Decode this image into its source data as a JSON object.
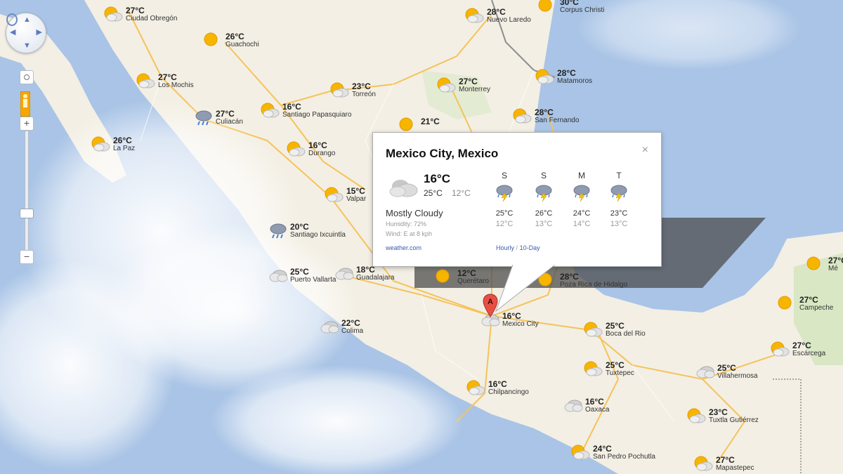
{
  "markers": [
    {
      "temp": "27°C",
      "city": "Ciudad Obregón",
      "icon": "sun-cloud-icon"
    },
    {
      "temp": "26°C",
      "city": "Guachochi",
      "icon": "sun-icon"
    },
    {
      "temp": "27°C",
      "city": "Los Mochis",
      "icon": "sun-cloud-icon"
    },
    {
      "temp": "27°C",
      "city": "Culiacán",
      "icon": "rain-cloud-icon"
    },
    {
      "temp": "26°C",
      "city": "La Paz",
      "icon": "sun-cloud-icon"
    },
    {
      "temp": "16°C",
      "city": "Santiago Papasquiaro",
      "icon": "sun-cloud-icon"
    },
    {
      "temp": "16°C",
      "city": "Durango",
      "icon": "sun-cloud-icon"
    },
    {
      "temp": "15°C",
      "city": "Valpar",
      "icon": "sun-cloud-icon"
    },
    {
      "temp": "20°C",
      "city": "Santiago Ixcuintla",
      "icon": "rain-cloud-icon"
    },
    {
      "temp": "25°C",
      "city": "Puerto Vallarta",
      "icon": "cloud-icon"
    },
    {
      "temp": "18°C",
      "city": "Guadalajara",
      "icon": "cloud-icon"
    },
    {
      "temp": "22°C",
      "city": "Colima",
      "icon": "cloud-icon"
    },
    {
      "temp": "23°C",
      "city": "Torreón",
      "icon": "sun-cloud-icon"
    },
    {
      "temp": "21°C",
      "city": "",
      "icon": "sun-icon"
    },
    {
      "temp": "28°C",
      "city": "Nuevo Laredo",
      "icon": "sun-cloud-icon"
    },
    {
      "temp": "30°C",
      "city": "Corpus Christi",
      "icon": "sun-icon"
    },
    {
      "temp": "27°C",
      "city": "Monterrey",
      "icon": "sun-cloud-icon"
    },
    {
      "temp": "28°C",
      "city": "Matamoros",
      "icon": "sun-cloud-icon"
    },
    {
      "temp": "28°C",
      "city": "San Fernando",
      "icon": "sun-cloud-icon"
    },
    {
      "temp": "12°C",
      "city": "Querétaro",
      "icon": "sun-icon"
    },
    {
      "temp": "28°C",
      "city": "Poza Rica de Hidalgo",
      "icon": "sun-icon"
    },
    {
      "temp": "16°C",
      "city": "Mexico City",
      "icon": "cloud-icon"
    },
    {
      "temp": "25°C",
      "city": "Boca del Rio",
      "icon": "sun-cloud-icon"
    },
    {
      "temp": "25°C",
      "city": "Tuxtepec",
      "icon": "sun-cloud-icon"
    },
    {
      "temp": "25°C",
      "city": "Villahermosa",
      "icon": "cloud-icon"
    },
    {
      "temp": "16°C",
      "city": "Chilpancingo",
      "icon": "sun-cloud-icon"
    },
    {
      "temp": "16°C",
      "city": "Oaxaca",
      "icon": "cloud-icon"
    },
    {
      "temp": "23°C",
      "city": "Tuxtla Gutiérrez",
      "icon": "sun-cloud-icon"
    },
    {
      "temp": "24°C",
      "city": "San Pedro Pochutla",
      "icon": "sun-cloud-icon"
    },
    {
      "temp": "27°C",
      "city": "Mapastepec",
      "icon": "sun-cloud-icon"
    },
    {
      "temp": "27°C",
      "city": "Campeche",
      "icon": "sun-icon"
    },
    {
      "temp": "27°C",
      "city": "Escárcega",
      "icon": "sun-cloud-icon"
    },
    {
      "temp": "27°C",
      "city": "Mé",
      "icon": "sun-icon"
    }
  ],
  "pin_letter": "A",
  "popup": {
    "title": "Mexico City, Mexico",
    "close": "×",
    "current_temp": "16°C",
    "hi": "25°C",
    "lo": "12°C",
    "condition": "Mostly Cloudy",
    "humidity": "Humidity: 72%",
    "wind": "Wind: E at 8 kph",
    "source": "weather.com",
    "link_hourly": "Hourly",
    "link_sep": "/",
    "link_10day": "10-Day",
    "forecast": [
      {
        "day": "S",
        "hi": "25°C",
        "lo": "12°C"
      },
      {
        "day": "S",
        "hi": "26°C",
        "lo": "13°C"
      },
      {
        "day": "M",
        "hi": "24°C",
        "lo": "14°C"
      },
      {
        "day": "T",
        "hi": "23°C",
        "lo": "13°C"
      }
    ]
  },
  "colors": {
    "ocean": "#a9c4e6",
    "land": "#f3efe4",
    "road": "#f5c35a",
    "sun": "#f7b500"
  }
}
